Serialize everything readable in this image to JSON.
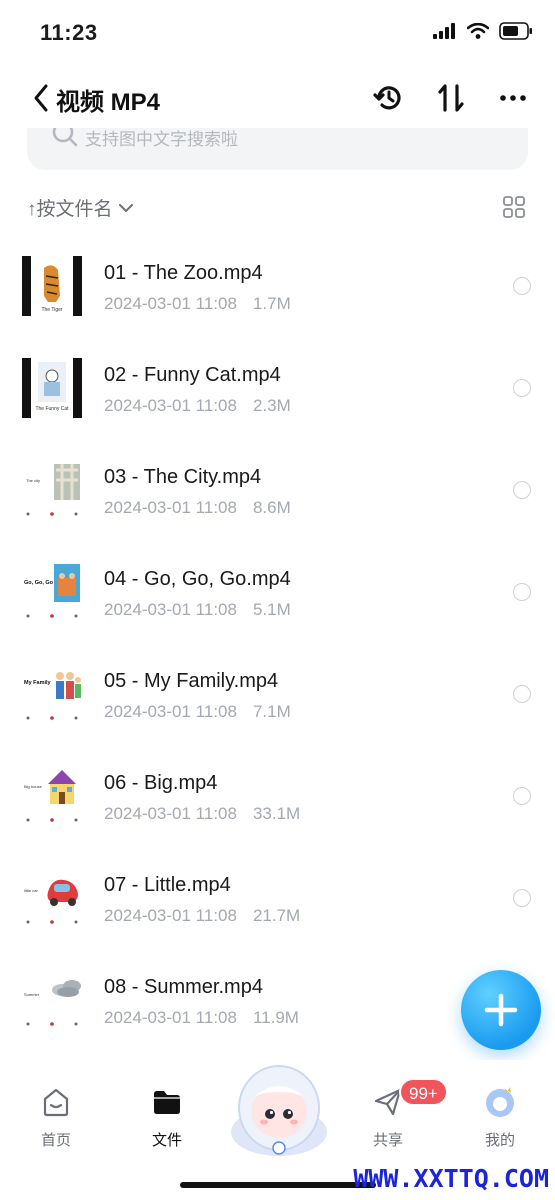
{
  "status": {
    "time": "11:23"
  },
  "header": {
    "title": "视频 MP4"
  },
  "search": {
    "placeholder": "支持图中文字搜索啦"
  },
  "sort": {
    "label": "↑按文件名"
  },
  "files": [
    {
      "name": "01 - The Zoo.mp4",
      "date": "2024-03-01 11:08",
      "size": "1.7M"
    },
    {
      "name": "02 - Funny Cat.mp4",
      "date": "2024-03-01 11:08",
      "size": "2.3M"
    },
    {
      "name": "03 - The City.mp4",
      "date": "2024-03-01 11:08",
      "size": "8.6M"
    },
    {
      "name": "04 - Go, Go, Go.mp4",
      "date": "2024-03-01 11:08",
      "size": "5.1M"
    },
    {
      "name": "05 - My Family.mp4",
      "date": "2024-03-01 11:08",
      "size": "7.1M"
    },
    {
      "name": "06 - Big.mp4",
      "date": "2024-03-01 11:08",
      "size": "33.1M"
    },
    {
      "name": "07 - Little.mp4",
      "date": "2024-03-01 11:08",
      "size": "21.7M"
    },
    {
      "name": "08 - Summer.mp4",
      "date": "2024-03-01 11:08",
      "size": "11.9M"
    }
  ],
  "thumb_captions": [
    "The Tiger",
    "The Funny Cat",
    "The city",
    "Go, Go, Go",
    "My Family",
    "Big house",
    "little car",
    "Summer"
  ],
  "tabs": [
    {
      "label": "首页",
      "icon": "home-icon"
    },
    {
      "label": "文件",
      "icon": "folder-icon"
    },
    {
      "label": "",
      "icon": "mascot-icon"
    },
    {
      "label": "共享",
      "icon": "share-icon"
    },
    {
      "label": "我的",
      "icon": "profile-icon"
    }
  ],
  "share_badge": "99+",
  "watermark": "WWW.XXTTQ.COM",
  "colors": {
    "accent": "#1a9bf0",
    "badge": "#f2545b",
    "watermark": "#1b24d8"
  }
}
